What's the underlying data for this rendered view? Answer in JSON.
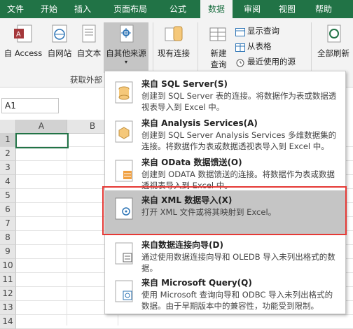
{
  "tabs": [
    "文件",
    "开始",
    "插入",
    "页面布局",
    "公式",
    "数据",
    "审阅",
    "视图",
    "帮助"
  ],
  "ribbon": {
    "buttons": {
      "access": "自 Access",
      "web": "自网站",
      "text": "自文本",
      "other": "自其他来源",
      "existing": "现有连接",
      "newquery_line1": "新建",
      "newquery_line2": "查询",
      "refresh": "全部刷新"
    },
    "small": {
      "show_query": "显示查询",
      "from_table": "从表格",
      "recent": "最近使用的源"
    },
    "group_label": "获取外部"
  },
  "namebox": "A1",
  "columns": [
    "A",
    "B"
  ],
  "rows": [
    "1",
    "2",
    "3",
    "4",
    "5",
    "6",
    "7",
    "8",
    "9",
    "10",
    "11",
    "12",
    "13",
    "14"
  ],
  "menu": [
    {
      "title": "来自 SQL Server(S)",
      "desc": "创建到 SQL Server 表的连接。将数据作为表或数据透视表导入到 Excel 中。"
    },
    {
      "title": "来自 Analysis Services(A)",
      "desc": "创建到 SQL Server Analysis Services 多维数据集的连接。将数据作为表或数据透视表导入到 Excel 中。"
    },
    {
      "title": "来自 OData 数据馈送(O)",
      "desc": "创建到 ODATA 数据馈送的连接。将数据作为表或数据透视表导入到 Excel 中。"
    },
    {
      "title": "来自 XML 数据导入(X)",
      "desc": "打开 XML 文件或将其映射到 Excel。"
    },
    {
      "title": "来自数据连接向导(D)",
      "desc": "通过使用数据连接向导和 OLEDB 导入未列出格式的数据。"
    },
    {
      "title": "来自 Microsoft Query(Q)",
      "desc": "使用 Microsoft 查询向导和 ODBC 导入未列出格式的数据。由于早期版本中的兼容性，功能受到限制。"
    }
  ],
  "colors": {
    "excel_green": "#217346",
    "highlight": "#c5c5c5",
    "red_box": "#e53935"
  }
}
